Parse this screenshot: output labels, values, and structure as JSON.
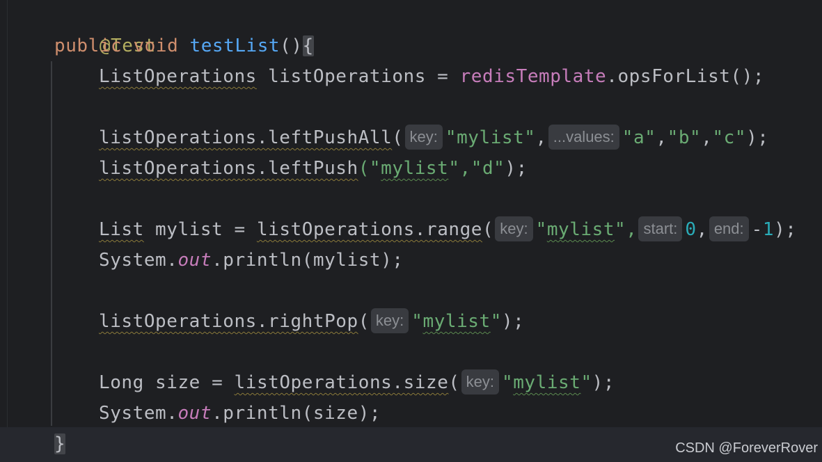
{
  "lines": {
    "l1": {
      "annotation": "@Test"
    },
    "l2": {
      "kw_public": "public",
      "kw_void": "void",
      "method": "testList",
      "paren": "()",
      "brace": "{"
    },
    "l3": {
      "type": "ListOperations",
      "var": "listOperations",
      "eq": "=",
      "field": "redisTemplate",
      "call": ".opsForList();"
    },
    "l4": {
      "recv": "listOperations.leftPushAll",
      "open": "(",
      "hint_key": "key:",
      "arg1": "\"mylist\"",
      "comma1": ",",
      "hint_values": "...values:",
      "arg2": "\"a\"",
      "arg3": "\"b\"",
      "arg4": "\"c\"",
      "comma": ",",
      "close": ");"
    },
    "l5": {
      "recv": "listOperations.leftPush",
      "open": "(\"",
      "arg1": "mylist",
      "mid": "\",",
      "arg2": "\"d\"",
      "close": ");"
    },
    "l6": {
      "type": "List",
      "var": "mylist",
      "eq": "=",
      "recv": "listOperations.range",
      "open": "(",
      "hint_key": "key:",
      "arg1_open": "\"",
      "arg1": "mylist",
      "arg1_close": "\",",
      "hint_start": "start:",
      "arg2": "0",
      "comma": ",",
      "hint_end": "end:",
      "minus": "-",
      "arg3": "1",
      "close": ");"
    },
    "l7": {
      "cls": "System.",
      "static": "out",
      "call": ".println(mylist);"
    },
    "l8": {
      "recv": "listOperations.rightPop",
      "open": "(",
      "hint_key": "key:",
      "arg_open": "\"",
      "arg": "mylist",
      "arg_close": "\"",
      "close": ");"
    },
    "l9": {
      "type": "Long",
      "var": "size",
      "eq": "=",
      "recv": "listOperations.size",
      "open": "(",
      "hint_key": "key:",
      "arg_open": "\"",
      "arg": "mylist",
      "arg_close": "\"",
      "close": ");"
    },
    "l10": {
      "cls": "System.",
      "static": "out",
      "call": ".println(size);"
    },
    "l11": {
      "brace": "}"
    }
  },
  "watermark": "CSDN @ForeverRover",
  "colors": {
    "background": "#1e1f22",
    "annotation": "#b3ae60",
    "keyword": "#cf8e6d",
    "method_decl": "#56a8f5",
    "field": "#c77dbb",
    "string": "#6aab73",
    "number": "#2aacb8",
    "text": "#bcbec4",
    "hint_bg": "#393b40"
  }
}
